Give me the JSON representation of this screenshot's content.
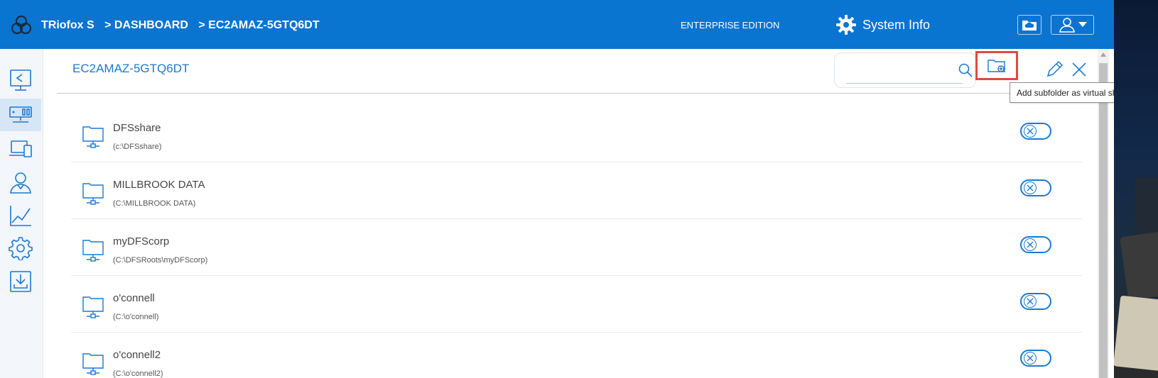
{
  "header": {
    "app_name": "TRiofox S",
    "breadcrumb": [
      "> DASHBOARD",
      "> EC2AMAZ-5GTQ6DT"
    ],
    "edition": "ENTERPRISE EDITION",
    "system_info_label": "System Info"
  },
  "sidebar": {
    "items": [
      {
        "icon": "share-icon"
      },
      {
        "icon": "servers-icon",
        "active": true
      },
      {
        "icon": "devices-icon"
      },
      {
        "icon": "users-icon"
      },
      {
        "icon": "reports-icon"
      },
      {
        "icon": "settings-icon"
      },
      {
        "icon": "download-icon"
      }
    ]
  },
  "panel": {
    "title": "EC2AMAZ-5GTQ6DT",
    "search_value": "",
    "tooltip": "Add subfolder as virtual share"
  },
  "shares": [
    {
      "name": "DFSshare",
      "path": "(c:\\DFSshare)"
    },
    {
      "name": "MILLBROOK DATA",
      "path": "(C:\\MILLBROOK DATA)"
    },
    {
      "name": "myDFScorp",
      "path": "(C:\\DFSRoots\\myDFScorp)"
    },
    {
      "name": "o'connell",
      "path": "(C:\\o'connell)"
    },
    {
      "name": "o'connell2",
      "path": "(C:\\o'connell2)"
    }
  ],
  "colors": {
    "header_bg": "#0a74d1",
    "accent": "#1b78d0",
    "highlight_border": "#e2483b"
  }
}
